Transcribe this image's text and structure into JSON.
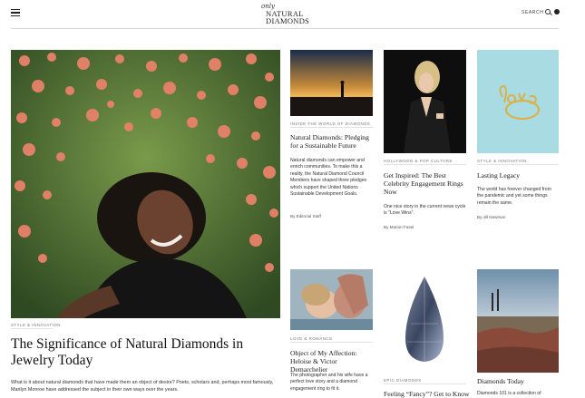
{
  "header": {
    "logo_only": "only",
    "logo_line1": "NATURAL",
    "logo_line2": "DIAMONDS",
    "search_label": "SEARCH"
  },
  "hero": {
    "tag": "STYLE & INNOVATION",
    "title": "The Significance of Natural Diamonds in Jewelry Today",
    "description": "What is it about natural diamonds that have made them an object of desire? Poets, scholars and, perhaps most famously, Marilyn Monroe have addressed the subject in their own ways over the years."
  },
  "cards_top": [
    {
      "tag": "INSIDE THE WORLD OF DIAMONDS",
      "title": "Natural Diamonds: Pledging for a Sustainable Future",
      "description": "Natural diamonds can empower and enrich communities. To make this a reality, the Natural Diamond Council Members have shaped three pledges which support the United Nations Sustainable Development Goals.",
      "byline": "By Editorial Staff"
    },
    {
      "tag": "HOLLYWOOD & POP CULTURE",
      "title": "Get Inspired: The Best Celebrity Engagement Rings Now",
      "description": "One nice story in the current news cycle is \"Love Wins\".",
      "byline": "By Marion Fasel"
    },
    {
      "tag": "STYLE & INNOVATION",
      "title": "Lasting Legacy",
      "description": "The world has forever changed from the pandemic and yet some things remain the same.",
      "byline": "By Jill Newman"
    }
  ],
  "cards_bottom": [
    {
      "tag": "LOVE & ROMANCE",
      "title": "Object of My Affection: Heloise & Victor Demarchelier",
      "description": "The photographer and his wife have a perfect love story and a diamond engagement ring to fit it."
    },
    {
      "tag": "EPIC DIAMONDS",
      "title": "Feeling “Fancy”? Get to Know"
    },
    {
      "tag": "",
      "title": "Diamonds Today",
      "description": "Diamonds 101 is a collection of"
    }
  ],
  "colors": {
    "text": "#1a1a1a",
    "tag": "#777777",
    "divider": "#d6d6d6"
  }
}
